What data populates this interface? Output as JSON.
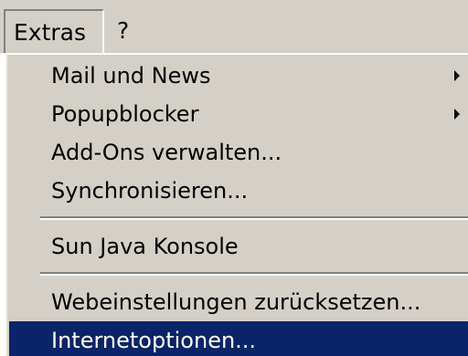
{
  "menubar": {
    "items": [
      {
        "label": "Extras",
        "state": "open"
      },
      {
        "label": "?"
      }
    ]
  },
  "dropdown": {
    "items": [
      {
        "label": "Mail und News",
        "submenu": true
      },
      {
        "label": "Popupblocker",
        "submenu": true
      },
      {
        "label": "Add-Ons verwalten..."
      },
      {
        "label": "Synchronisieren..."
      },
      {
        "separator": true
      },
      {
        "label": "Sun Java Konsole"
      },
      {
        "separator": true
      },
      {
        "label": "Webeinstellungen zurücksetzen..."
      },
      {
        "label": "Internetoptionen...",
        "highlighted": true
      }
    ]
  },
  "colors": {
    "menu_background": "#d4d0c8",
    "highlight_background": "#0a246a",
    "highlight_text": "#ffffff"
  },
  "icons": {
    "submenu": "chevron-right-icon"
  }
}
